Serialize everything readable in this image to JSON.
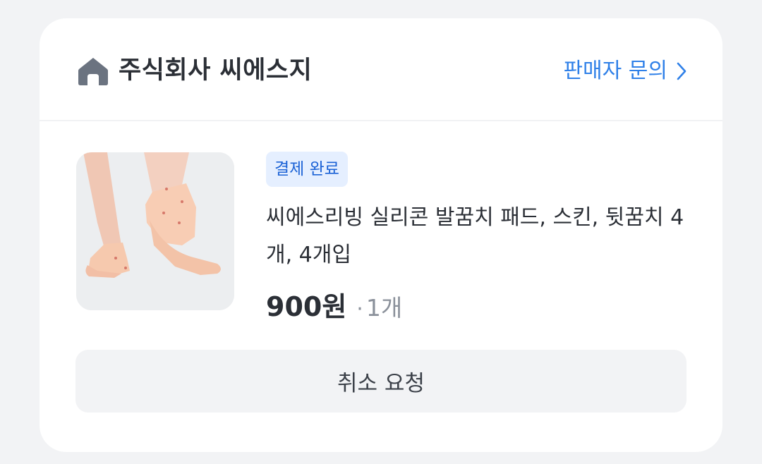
{
  "seller": {
    "icon": "store-icon",
    "name": "주식회사 씨에스지",
    "inquiry_label": "판매자 문의",
    "inquiry_icon": "chevron-right-icon"
  },
  "order_item": {
    "image_alt": "발꿈치 패드를 착용한 발",
    "status_badge": "결제 완료",
    "title": "씨에스리빙 실리콘 발꿈치 패드, 스킨, 뒷꿈치 4개, 4개입",
    "price": "900원",
    "quantity_separator": "·",
    "quantity": "1개"
  },
  "actions": {
    "cancel_label": "취소 요청"
  },
  "colors": {
    "accent": "#2f80e8",
    "badge_bg": "#e5efff",
    "badge_text": "#1c63d6",
    "page_bg": "#f2f3f5",
    "text_primary": "#2b2f36",
    "text_muted": "#8b919b"
  }
}
